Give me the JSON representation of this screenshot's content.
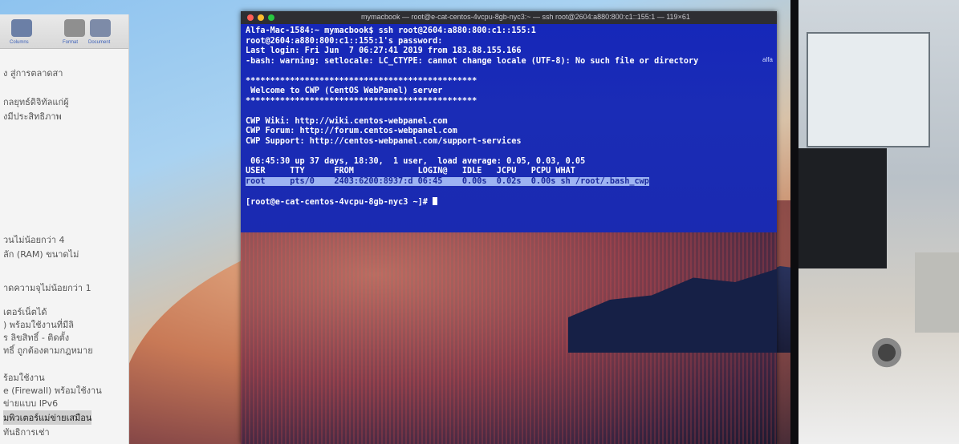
{
  "sidebar": {
    "toolbar_labels": [
      "Columns",
      "Format",
      "Document"
    ],
    "lines": [
      "ง สู่การตลาดสา",
      "กลยุทธ์ดิจิทัลแก่ผู้",
      "งมีประสิทธิภาพ",
      "วนไม่น้อยกว่า 4",
      "ลัก (RAM) ขนาดไม่",
      "าดความจุไม่น้อยกว่า 1",
      "เตอร์เน็ตได้",
      ") พร้อมใช้งานที่มีลิ",
      "ร ลิขสิทธิ์ - ติดตั้ง",
      "ทธิ์ ถูกต้องตามกฎหมาย",
      "ร้อมใช้งาน",
      "e (Firewall) พร้อมใช้งาน",
      "ข่ายแบบ IPv6",
      "มพิวเตอร์แม่ข่ายเสมือน",
      "ทันธิการเช่า"
    ]
  },
  "terminal": {
    "title": "mymacbook — root@e-cat-centos-4vcpu-8gb-nyc3:~ — ssh root@2604:a880:800:c1::155:1 — 119×61",
    "lines": [
      "Alfa-Mac-1584:~ mymacbook$ ssh root@2604:a880:800:c1::155:1",
      "root@2604:a880:800:c1::155:1's password:",
      "Last login: Fri Jun  7 06:27:41 2019 from 183.88.155.166",
      "-bash: warning: setlocale: LC_CTYPE: cannot change locale (UTF-8): No such file or directory",
      "",
      "***********************************************",
      " Welcome to CWP (CentOS WebPanel) server",
      "***********************************************",
      "",
      "CWP Wiki: http://wiki.centos-webpanel.com",
      "CWP Forum: http://forum.centos-webpanel.com",
      "CWP Support: http://centos-webpanel.com/support-services",
      "",
      " 06:45:30 up 37 days, 18:30,  1 user,  load average: 0.05, 0.03, 0.05",
      "USER     TTY      FROM             LOGIN@   IDLE   JCPU   PCPU WHAT"
    ],
    "selected_line": "root     pts/0    2403:6200:8937:d 06:45    0.00s  0.02s  0.00s sh /root/.bash_cwp",
    "prompt": "[root@e-cat-centos-4vcpu-8gb-nyc3 ~]# ",
    "side_label": "alfa"
  },
  "colors": {
    "terminal_bg": "#1a2ab1",
    "selection_bg": "#9db3f2"
  }
}
